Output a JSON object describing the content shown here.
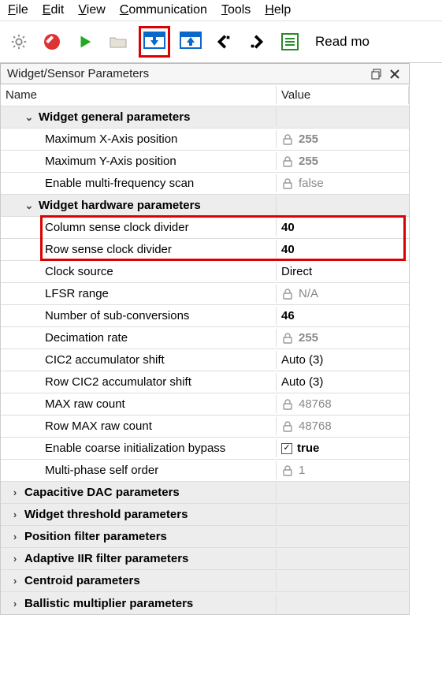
{
  "menu": {
    "file": "File",
    "edit": "Edit",
    "view": "View",
    "communication": "Communication",
    "tools": "Tools",
    "help": "Help"
  },
  "toolbar": {
    "read_label": "Read mo"
  },
  "panel": {
    "title": "Widget/Sensor Parameters",
    "col_name": "Name",
    "col_value": "Value"
  },
  "groups": {
    "general": "Widget general parameters",
    "hardware": "Widget hardware parameters",
    "capdac": "Capacitive DAC parameters",
    "threshold": "Widget threshold parameters",
    "posfilter": "Position filter parameters",
    "adaptive": "Adaptive IIR filter parameters",
    "centroid": "Centroid parameters",
    "ballistic": "Ballistic multiplier parameters"
  },
  "params": {
    "max_x": {
      "name": "Maximum X-Axis position",
      "value": "255"
    },
    "max_y": {
      "name": "Maximum Y-Axis position",
      "value": "255"
    },
    "multi_freq": {
      "name": "Enable multi-frequency scan",
      "value": "false"
    },
    "col_clk": {
      "name": "Column sense clock divider",
      "value": "40"
    },
    "row_clk": {
      "name": "Row sense clock divider",
      "value": "40"
    },
    "clk_src": {
      "name": "Clock source",
      "value": "Direct"
    },
    "lfsr": {
      "name": "LFSR range",
      "value": "N/A"
    },
    "subconv": {
      "name": "Number of sub-conversions",
      "value": "46"
    },
    "decim": {
      "name": "Decimation rate",
      "value": "255"
    },
    "cic2": {
      "name": "CIC2 accumulator shift",
      "value": "Auto (3)"
    },
    "row_cic2": {
      "name": "Row CIC2 accumulator shift",
      "value": "Auto (3)"
    },
    "max_raw": {
      "name": "MAX raw count",
      "value": "48768"
    },
    "row_max_raw": {
      "name": "Row MAX raw count",
      "value": "48768"
    },
    "coarse": {
      "name": "Enable coarse initialization bypass",
      "value": "true"
    },
    "mpso": {
      "name": "Multi-phase self order",
      "value": "1"
    }
  }
}
